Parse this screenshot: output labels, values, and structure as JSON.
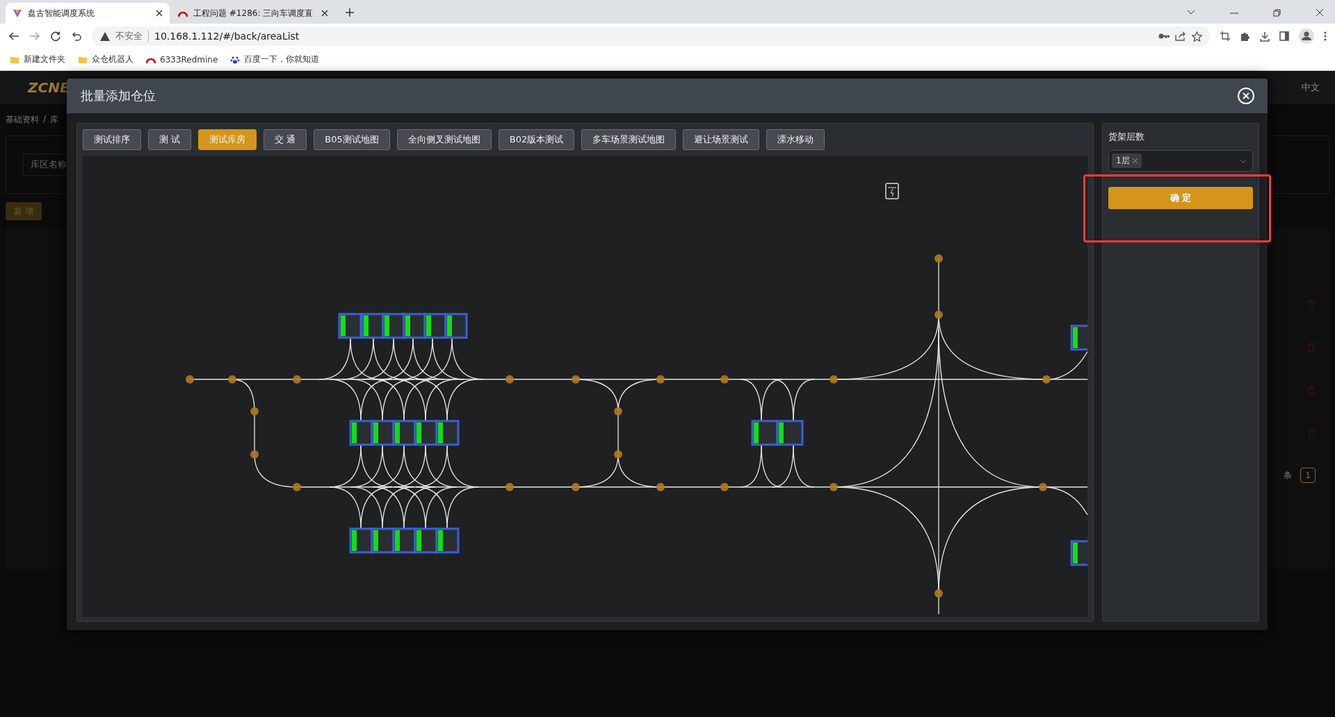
{
  "browser": {
    "tabs": [
      {
        "title": "盘古智能调度系统",
        "selected": true
      },
      {
        "title": "工程问题 #1286: 三向车调度直",
        "selected": false
      }
    ],
    "security": "不安全",
    "url": "10.168.1.112/#/back/areaList",
    "bookmarks": [
      {
        "label": "新建文件夹",
        "kind": "folder"
      },
      {
        "label": "众仓机器人",
        "kind": "folder"
      },
      {
        "label": "6333Redmine",
        "kind": "redmine"
      },
      {
        "label": "百度一下，你就知道",
        "kind": "baidu"
      }
    ]
  },
  "page": {
    "logo": "ZCNE",
    "language": "中文",
    "breadcrumb": [
      "基础资料",
      "库"
    ],
    "breadcrumb_separator": "/",
    "search_placeholder": "库区名称",
    "add_button": "新 增",
    "pagination": {
      "total_suffix": "条",
      "pages": [
        {
          "label": "1",
          "selected": true
        }
      ]
    }
  },
  "modal": {
    "title": "批量添加仓位",
    "map_tabs": [
      {
        "label": "测试排序",
        "selected": false
      },
      {
        "label": "测 试",
        "selected": false
      },
      {
        "label": "测试库房",
        "selected": true
      },
      {
        "label": "交 通",
        "selected": false
      },
      {
        "label": "B05测试地图",
        "selected": false
      },
      {
        "label": "全向侧叉测试地图",
        "selected": false
      },
      {
        "label": "B02版本测试",
        "selected": false
      },
      {
        "label": "多车场景测试地图",
        "selected": false
      },
      {
        "label": "避让场景测试",
        "selected": false
      },
      {
        "label": "溧水移动",
        "selected": false
      }
    ],
    "shelf_levels": {
      "label": "货架层数",
      "tags": [
        "1层"
      ]
    },
    "confirm": "确 定"
  }
}
